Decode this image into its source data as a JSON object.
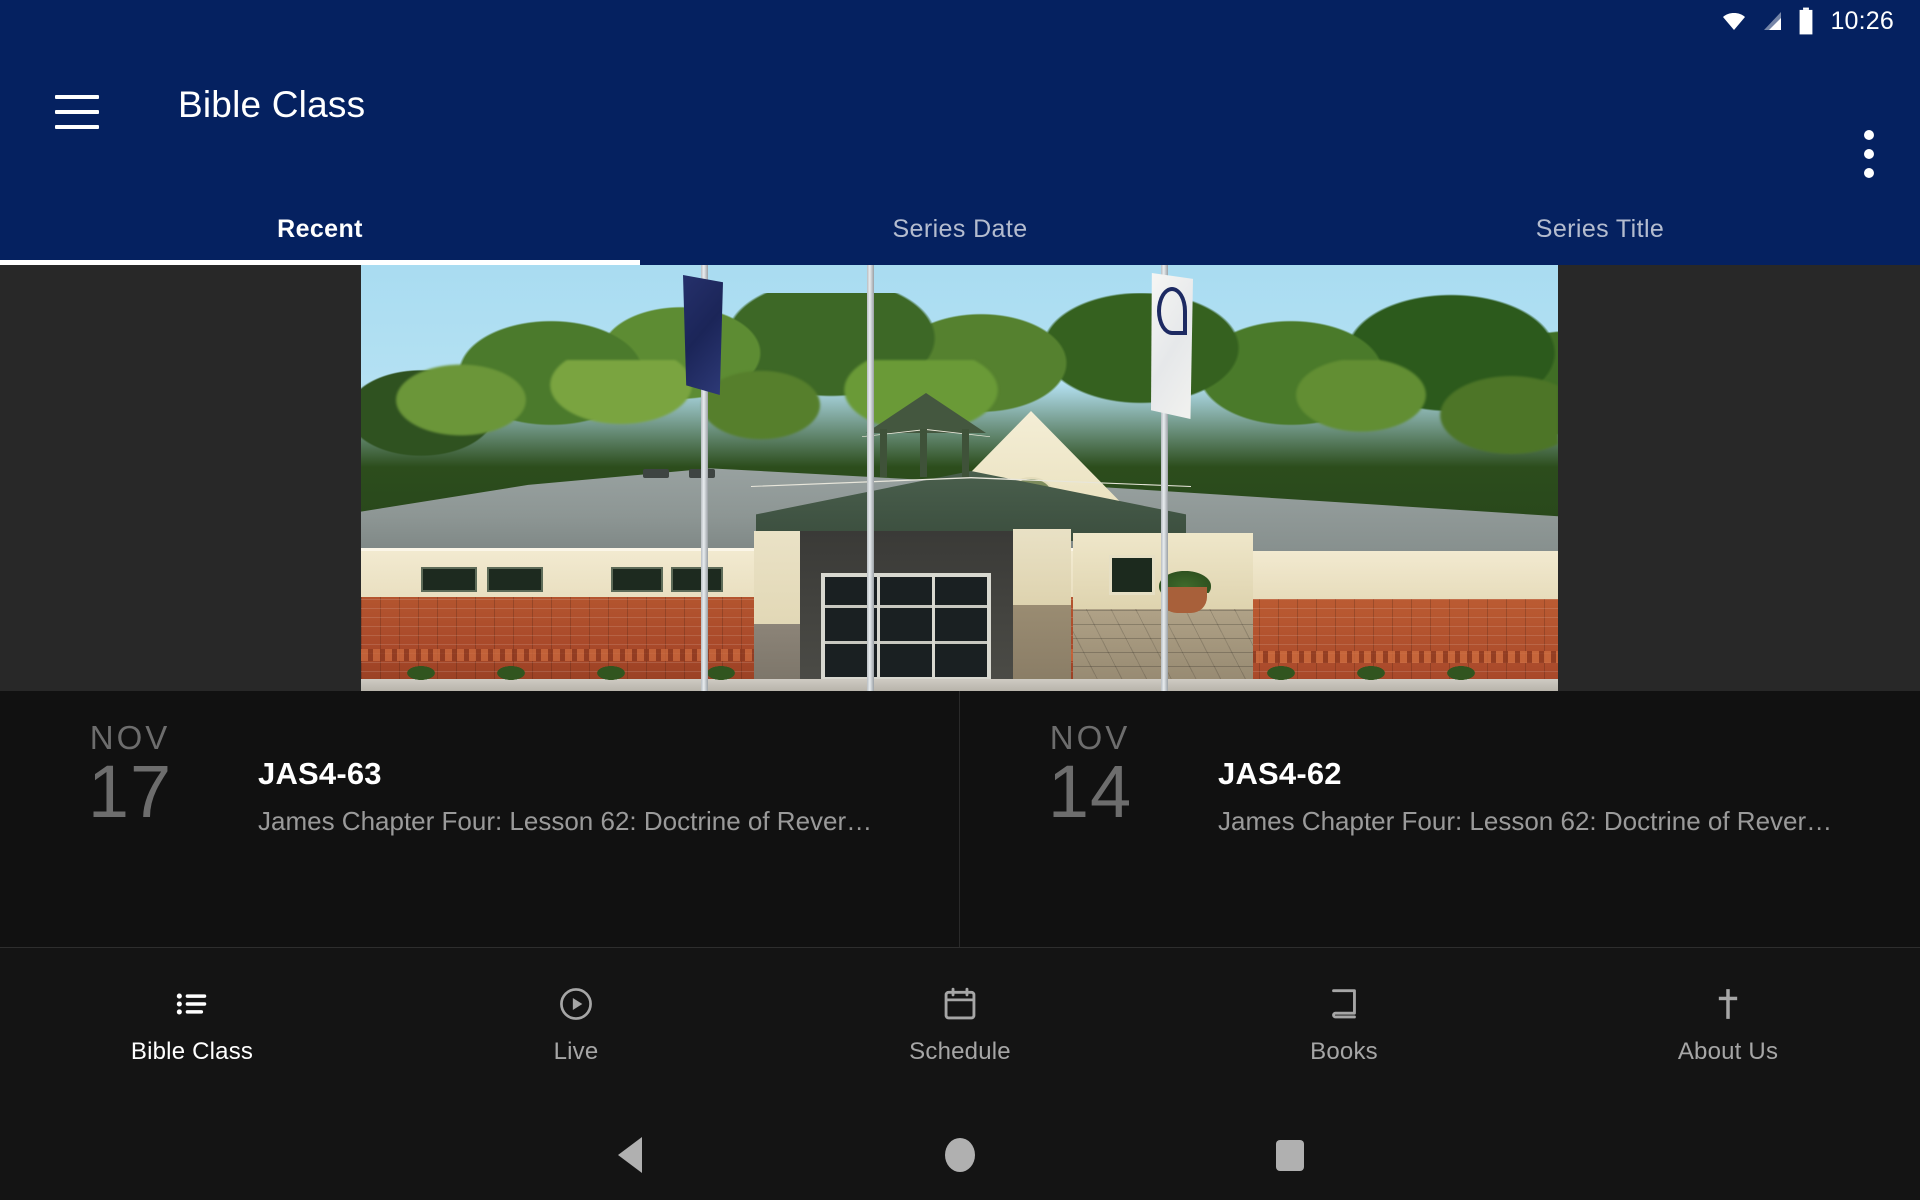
{
  "status_bar": {
    "time": "10:26",
    "icons": [
      "wifi-icon",
      "cellular-signal-icon",
      "battery-icon"
    ]
  },
  "toolbar": {
    "menu_icon": "hamburger-menu-icon",
    "title": "Bible Class",
    "overflow_icon": "more-vert-icon"
  },
  "tabs": {
    "items": [
      {
        "label": "Recent",
        "active": true
      },
      {
        "label": "Series Date",
        "active": false
      },
      {
        "label": "Series Title",
        "active": false
      }
    ],
    "active_index": 0
  },
  "hero": {
    "alt": "church-building-photo",
    "description": "Exterior photo of a church building at sunrise with green trees, covered entrance portico, brick facade and three flagpoles"
  },
  "list": {
    "items": [
      {
        "month": "NOV",
        "day": "17",
        "code": "JAS4-63",
        "description": "James Chapter Four: Lesson 62: Doctrine of Rever…"
      },
      {
        "month": "NOV",
        "day": "14",
        "code": "JAS4-62",
        "description": "James Chapter Four: Lesson 62: Doctrine of Rever…"
      }
    ]
  },
  "bottom_nav": {
    "items": [
      {
        "label": "Bible Class",
        "icon": "list-bulleted-icon",
        "active": true
      },
      {
        "label": "Live",
        "icon": "play-circle-icon",
        "active": false
      },
      {
        "label": "Schedule",
        "icon": "calendar-icon",
        "active": false
      },
      {
        "label": "Books",
        "icon": "book-icon",
        "active": false
      },
      {
        "label": "About Us",
        "icon": "cross-icon",
        "active": false
      }
    ]
  },
  "system_nav": {
    "back": "back-triangle-icon",
    "home": "home-circle-icon",
    "recents": "recents-square-icon"
  },
  "colors": {
    "toolbar_blue": "#052160",
    "surface_dark": "#111111",
    "nav_dark": "#141414",
    "accent_white": "#FFFFFF",
    "muted_text": "#9A9A9A",
    "date_text": "#6D6D6D"
  }
}
